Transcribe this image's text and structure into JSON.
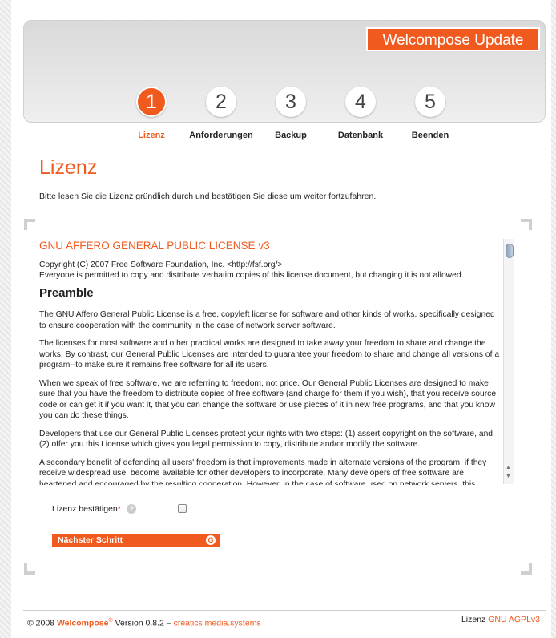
{
  "header": {
    "brand_title": "Welcompose Update"
  },
  "steps": [
    {
      "number": "1",
      "label": "Lizenz",
      "active": true
    },
    {
      "number": "2",
      "label": "Anforderungen",
      "active": false
    },
    {
      "number": "3",
      "label": "Backup",
      "active": false
    },
    {
      "number": "4",
      "label": "Datenbank",
      "active": false
    },
    {
      "number": "5",
      "label": "Beenden",
      "active": false
    }
  ],
  "main": {
    "title": "Lizenz",
    "intro": "Bitte lesen Sie die Lizenz gründlich durch und bestätigen Sie diese um weiter fortzufahren."
  },
  "license": {
    "heading": "GNU AFFERO GENERAL PUBLIC LICENSE v3",
    "copyright": "Copyright (C) 2007 Free Software Foundation, Inc. <http://fsf.org/>",
    "permission": "Everyone is permitted to copy and distribute verbatim copies of this license document, but changing it is not allowed.",
    "preamble_title": "Preamble",
    "paragraphs": [
      "The GNU Affero General Public License is a free, copyleft license for software and other kinds of works, specifically designed to ensure cooperation with the community in the case of network server software.",
      "The licenses for most software and other practical works are designed to take away your freedom to share and change the works. By contrast, our General Public Licenses are intended to guarantee your freedom to share and change all versions of a program--to make sure it remains free software for all its users.",
      "When we speak of free software, we are referring to freedom, not price. Our General Public Licenses are designed to make sure that you have the freedom to distribute copies of free software (and charge for them if you wish), that you receive source code or can get it if you want it, that you can change the software or use pieces of it in new free programs, and that you know you can do these things.",
      "Developers that use our General Public Licenses protect your rights with two steps: (1) assert copyright on the software, and (2) offer you this License which gives you legal permission to copy, distribute and/or modify the software.",
      "A secondary benefit of defending all users' freedom is that improvements made in alternate versions of the program, if they receive widespread use, become available for other developers to incorporate. Many developers of free software are heartened and encouraged by the resulting cooperation. However, in the case of software used on network servers, this"
    ]
  },
  "form": {
    "confirm_label": "Lizenz bestätigen",
    "required_mark": "*",
    "help_glyph": "?",
    "next_button": "Nächster Schritt",
    "next_icon_glyph": "G"
  },
  "footer": {
    "copyright_prefix": "© 2008 ",
    "brand": "Welcompose",
    "registered": "®",
    "version": " Version 0.8.2 – ",
    "company": "creatics media.systems",
    "license_prefix": "Lizenz ",
    "license_link": "GNU AGPLv3"
  },
  "colors": {
    "accent": "#f15a1f"
  }
}
